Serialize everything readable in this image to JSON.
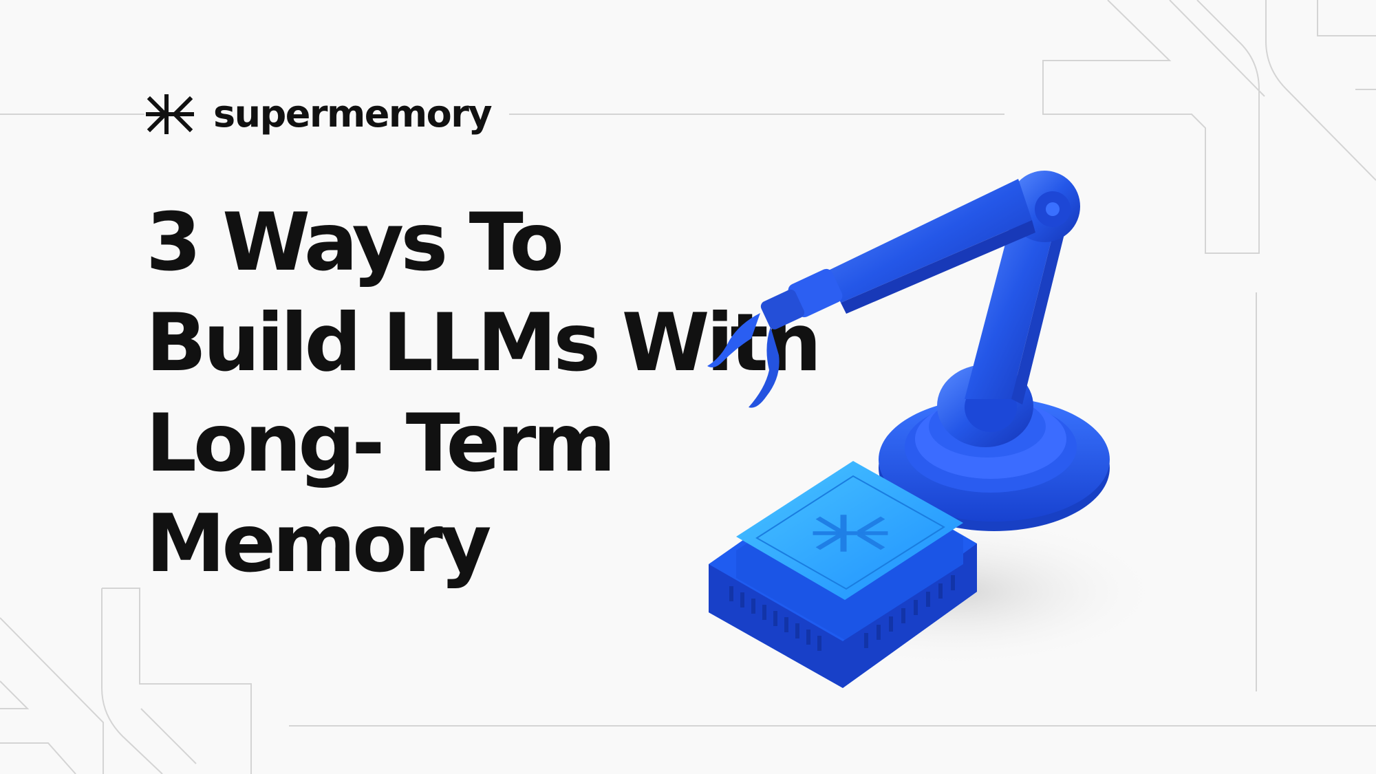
{
  "brand": {
    "name": "supermemory",
    "logo_icon": "supermemory-logo-icon"
  },
  "headline": {
    "lines": [
      "3 Ways To",
      "Build LLMs With",
      "Long- Term",
      "Memory"
    ]
  },
  "illustration": {
    "robot_arm_icon": "robot-arm-icon",
    "chip_icon": "memory-chip-icon"
  },
  "colors": {
    "background": "#f9f9f9",
    "text": "#111111",
    "accent_blue": "#1f5cf0",
    "chip_cyan": "#2ea8ff",
    "line_gray": "#d2d2d2"
  }
}
